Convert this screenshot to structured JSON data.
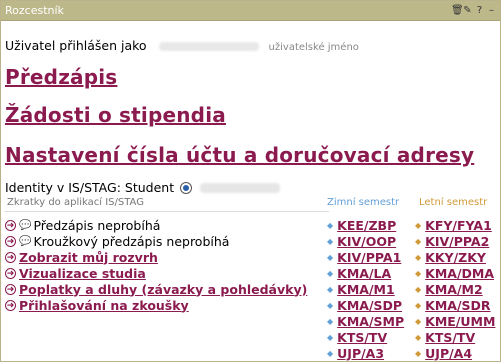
{
  "panel": {
    "title": "Rozcestník"
  },
  "user": {
    "logged_in": "Uživatel přihlášen jako",
    "username_hint": "uživatelské jméno"
  },
  "links": [
    "Předzápis",
    "Žádosti o stipendia",
    "Nastavení čísla účtu a doručovací adresy"
  ],
  "identity": {
    "label": "Identity v IS/STAG: Student"
  },
  "shortcuts": {
    "header": "Zkratky do aplikací IS/STAG",
    "winter": "Zimní semestr",
    "summer": "Letní semestr"
  },
  "apps": [
    {
      "text": "Předzápis neprobíhá"
    },
    {
      "text": "Kroužkový předzápis neprobíhá"
    },
    {
      "text": "Zobrazit můj rozvrh"
    },
    {
      "text": "Vizualizace studia"
    },
    {
      "text": "Poplatky a dluhy (závazky a pohledávky)"
    },
    {
      "text": "Přihlašování na zkoušky"
    }
  ],
  "winter_courses": [
    "KEE/ZBP",
    "KIV/OOP",
    "KIV/PPA1",
    "KMA/LA",
    "KMA/M1",
    "KMA/SDP",
    "KMA/SMP",
    "KTS/TV",
    "UJP/A3"
  ],
  "summer_courses": [
    "KFY/FYA1",
    "KIV/PPA2",
    "KKY/ZKY",
    "KMA/DMA",
    "KMA/M2",
    "KMA/SDR",
    "KME/UMM",
    "KTS/TV",
    "UJP/A4"
  ]
}
